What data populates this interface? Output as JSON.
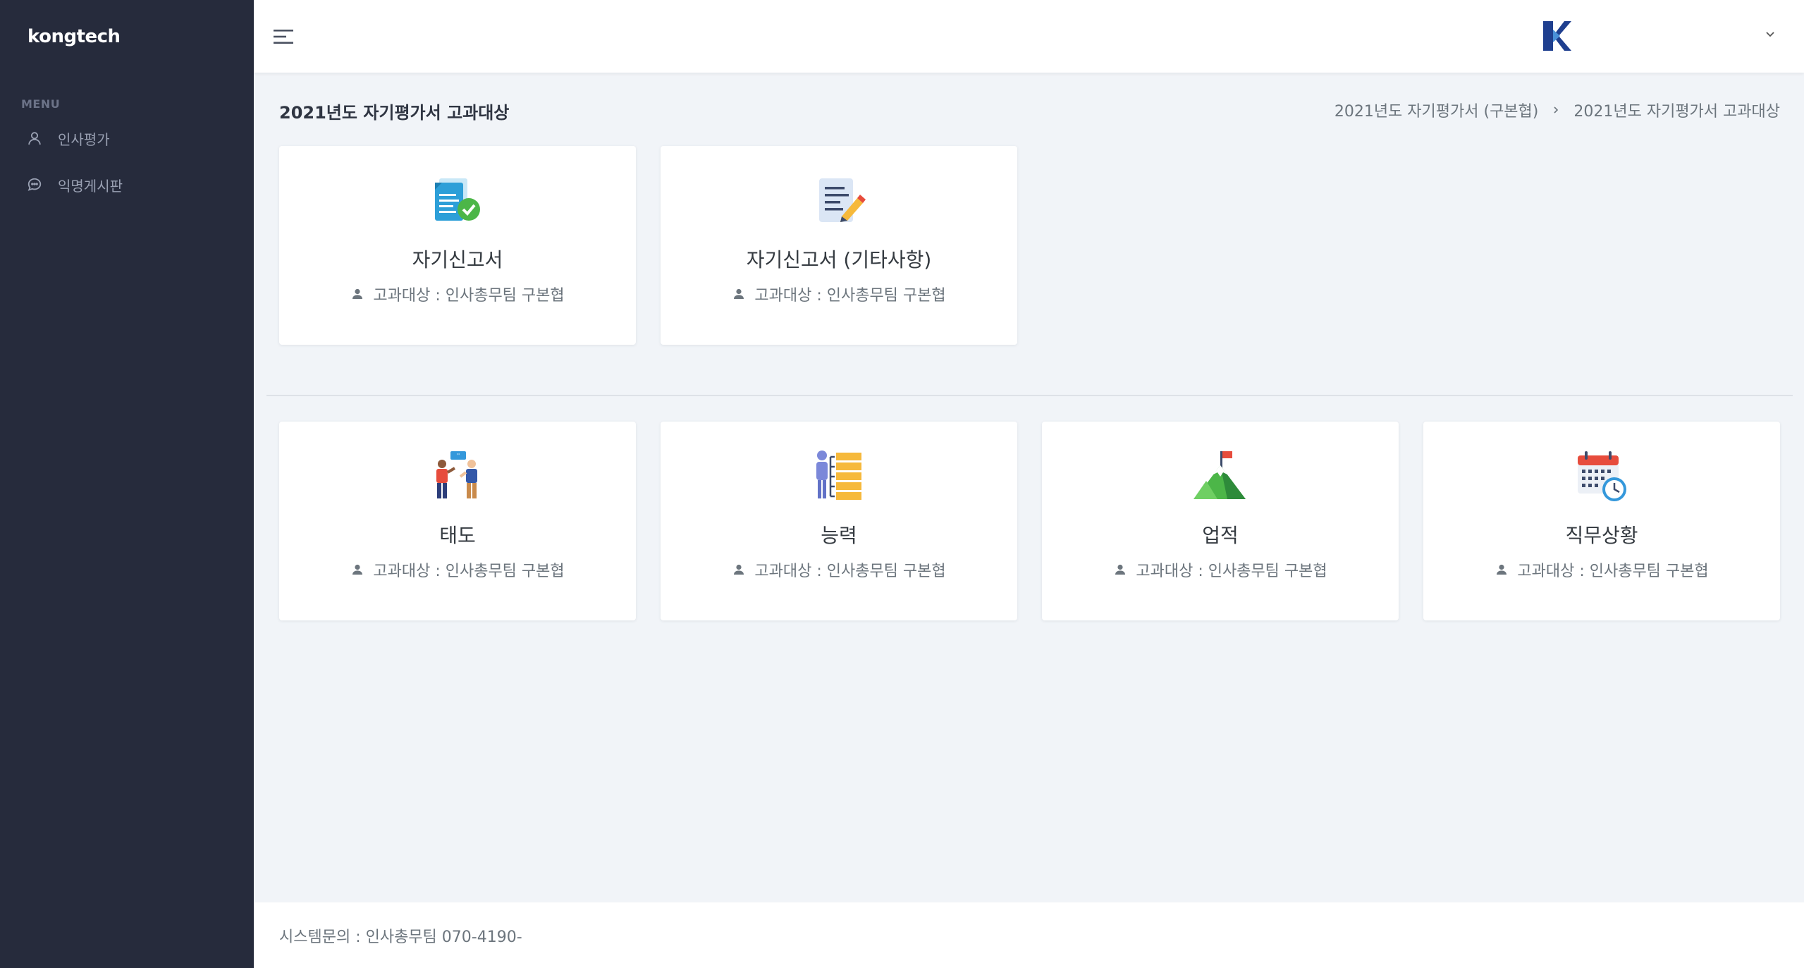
{
  "sidebar": {
    "brand": "kongtech",
    "menu_title": "MENU",
    "items": [
      {
        "label": "인사평가",
        "icon": "user-icon"
      },
      {
        "label": "익명게시판",
        "icon": "chat-icon"
      }
    ]
  },
  "header": {
    "menu_icon": "hamburger-icon",
    "logo_icon": "k-logo-icon",
    "user_menu_icon": "chevron-down-icon"
  },
  "page": {
    "title": "2021년도 자기평가서 고과대상",
    "breadcrumb": [
      "2021년도 자기평가서 (구본협)",
      "2021년도 자기평가서 고과대상"
    ]
  },
  "cards_top": [
    {
      "title": "자기신고서",
      "subtitle": "고과대상 : 인사총무팀 구본협",
      "icon": "document-check-icon"
    },
    {
      "title": "자기신고서 (기타사항)",
      "subtitle": "고과대상 : 인사총무팀 구본협",
      "icon": "document-pencil-icon"
    }
  ],
  "cards_bottom": [
    {
      "title": "태도",
      "subtitle": "고과대상 : 인사총무팀 구본협",
      "icon": "people-talk-icon"
    },
    {
      "title": "능력",
      "subtitle": "고과대상 : 인사총무팀 구본협",
      "icon": "person-list-icon"
    },
    {
      "title": "업적",
      "subtitle": "고과대상 : 인사총무팀 구본협",
      "icon": "mountain-flag-icon"
    },
    {
      "title": "직무상황",
      "subtitle": "고과대상 : 인사총무팀 구본협",
      "icon": "calendar-clock-icon"
    }
  ],
  "footer": {
    "text": "시스템문의 : 인사총무팀 070-4190-"
  },
  "colors": {
    "sidebar_bg": "#262b3c",
    "page_bg": "#f1f4f8",
    "logo_blue": "#1f3f8f"
  }
}
